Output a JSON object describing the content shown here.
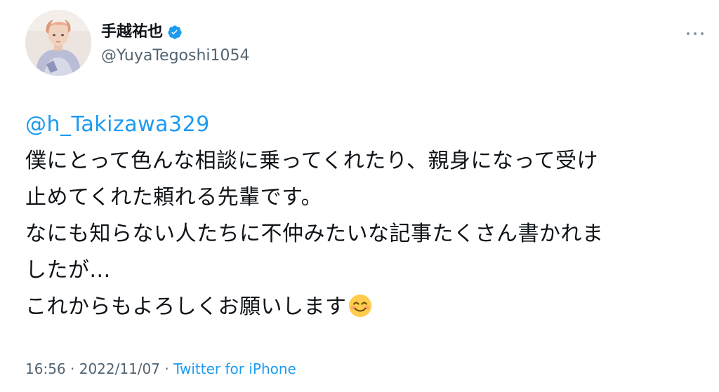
{
  "author": {
    "display_name": "手越祐也",
    "handle": "@YuyaTegoshi1054",
    "verified": true
  },
  "tweet": {
    "mention": "@h_Takizawa329",
    "lines": [
      "僕にとって色んな相談に乗ってくれたり、親身になって受け",
      "止めてくれた頼れる先輩です。",
      "なにも知らない人たちに不仲みたいな記事たくさん書かれま",
      "したが...",
      "これからもよろしくお願いします"
    ],
    "emoji": "smiling-face-with-smiling-eyes"
  },
  "meta": {
    "time": "16:56",
    "separator": "·",
    "date": "2022/11/07",
    "source": "Twitter for iPhone"
  },
  "colors": {
    "link": "#1d9bf0",
    "text": "#0f1419",
    "secondary": "#536471"
  }
}
